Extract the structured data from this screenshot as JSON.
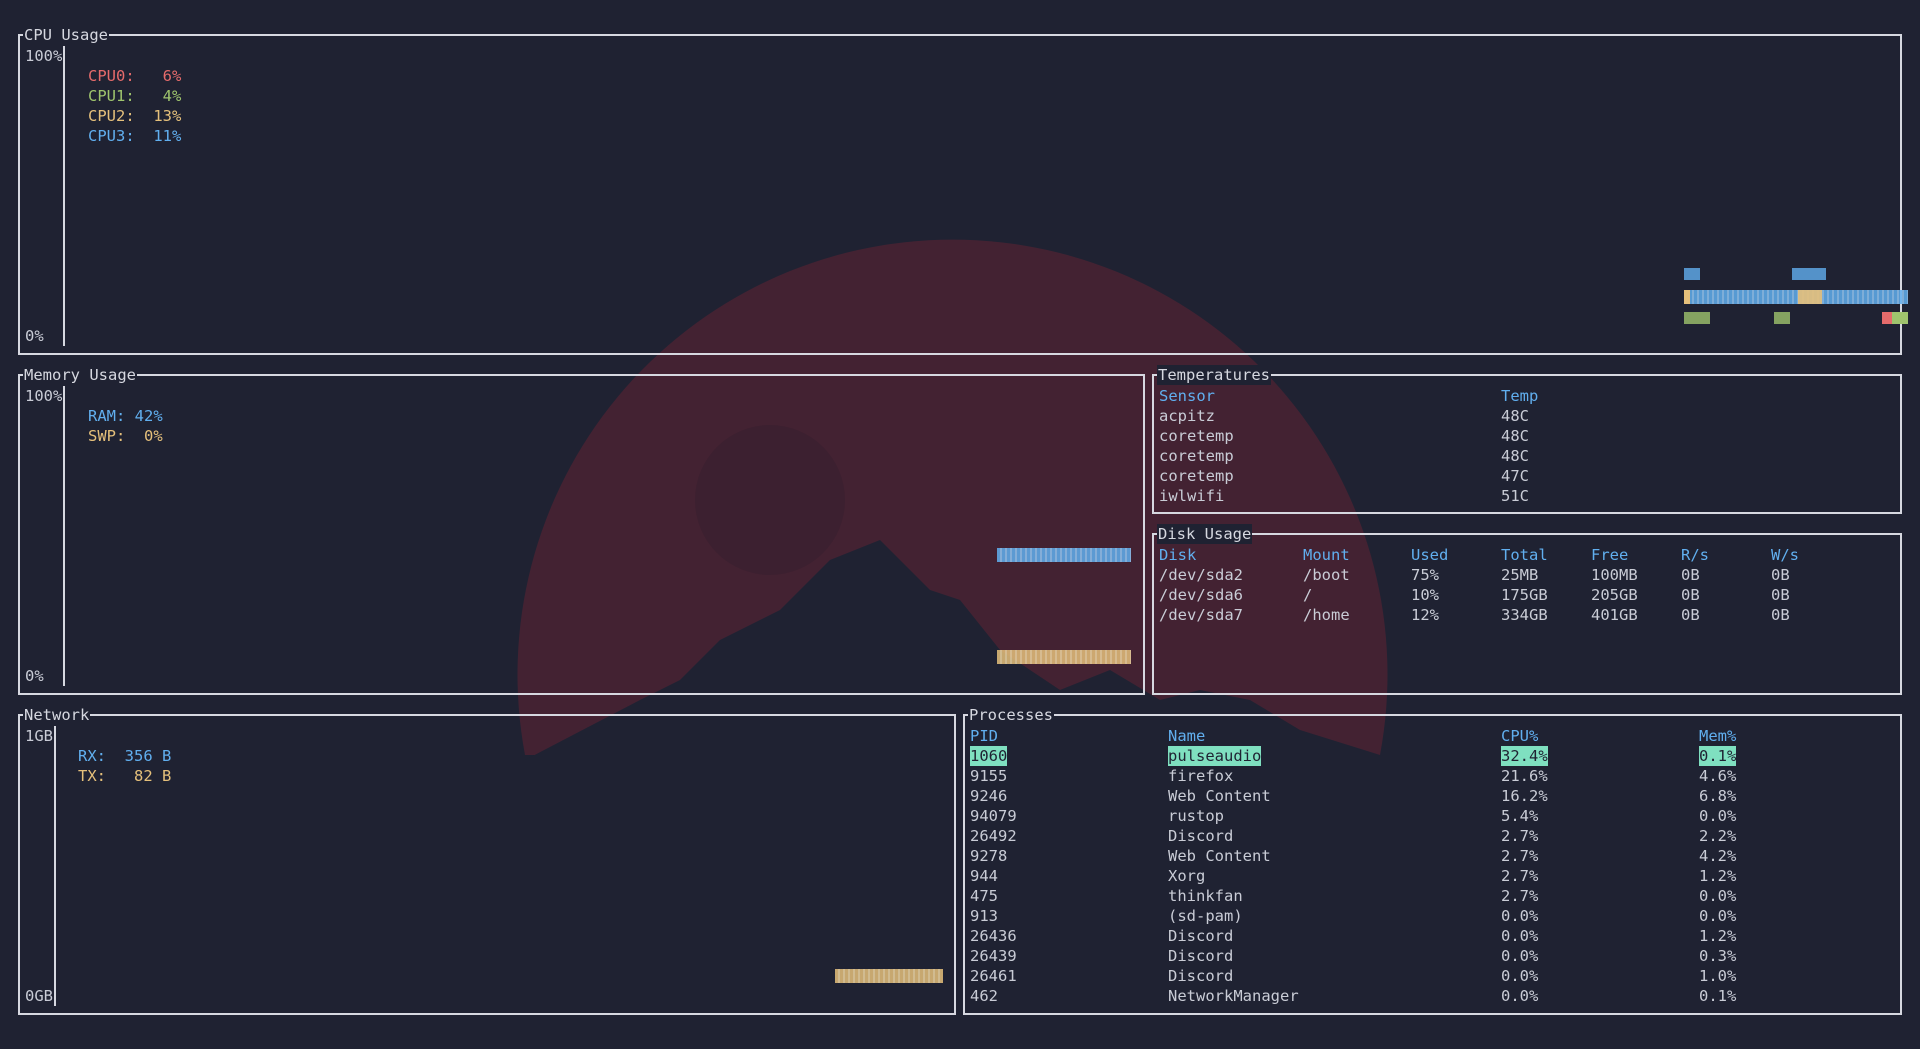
{
  "cpu": {
    "title": "CPU Usage",
    "y_max": "100%",
    "y_min": "0%",
    "cores": [
      {
        "name": "CPU0:",
        "value": "6%",
        "color": "#e56b6b"
      },
      {
        "name": "CPU1:",
        "value": "4%",
        "color": "#9fc46d"
      },
      {
        "name": "CPU2:",
        "value": "13%",
        "color": "#e5c07b"
      },
      {
        "name": "CPU3:",
        "value": "11%",
        "color": "#61afef"
      }
    ]
  },
  "memory": {
    "title": "Memory Usage",
    "y_max": "100%",
    "y_min": "0%",
    "ram": {
      "label": "RAM:",
      "value": "42%",
      "color": "#61afef"
    },
    "swp": {
      "label": "SWP:",
      "value": "0%",
      "color": "#e5c07b"
    }
  },
  "temperatures": {
    "title": "Temperatures",
    "columns": [
      "Sensor",
      "Temp"
    ],
    "rows": [
      [
        "acpitz",
        "48C"
      ],
      [
        "coretemp",
        "48C"
      ],
      [
        "coretemp",
        "48C"
      ],
      [
        "coretemp",
        "47C"
      ],
      [
        "iwlwifi",
        "51C"
      ]
    ]
  },
  "disk": {
    "title": "Disk Usage",
    "columns": [
      "Disk",
      "Mount",
      "Used",
      "Total",
      "Free",
      "R/s",
      "W/s"
    ],
    "rows": [
      [
        "/dev/sda2",
        "/boot",
        "75%",
        "25MB",
        "100MB",
        "0B",
        "0B"
      ],
      [
        "/dev/sda6",
        "/",
        "10%",
        "175GB",
        "205GB",
        "0B",
        "0B"
      ],
      [
        "/dev/sda7",
        "/home",
        "12%",
        "334GB",
        "401GB",
        "0B",
        "0B"
      ]
    ]
  },
  "network": {
    "title": "Network",
    "y_max": "1GB",
    "y_min": "0GB",
    "rx": {
      "label": "RX:",
      "value": "356 B",
      "color": "#61afef"
    },
    "tx": {
      "label": "TX:",
      "value": "82 B",
      "color": "#e5c07b"
    }
  },
  "processes": {
    "title": "Processes",
    "columns": [
      "PID",
      "Name",
      "CPU%",
      "Mem%"
    ],
    "rows": [
      [
        "1060",
        "pulseaudio",
        "32.4%",
        "0.1%"
      ],
      [
        "9155",
        "firefox",
        "21.6%",
        "4.6%"
      ],
      [
        "9246",
        "Web Content",
        "16.2%",
        "6.8%"
      ],
      [
        "94079",
        "rustop",
        "5.4%",
        "0.0%"
      ],
      [
        "26492",
        "Discord",
        "2.7%",
        "2.2%"
      ],
      [
        "9278",
        "Web Content",
        "2.7%",
        "4.2%"
      ],
      [
        "944",
        "Xorg",
        "2.7%",
        "1.2%"
      ],
      [
        "475",
        "thinkfan",
        "2.7%",
        "0.0%"
      ],
      [
        "913",
        "(sd-pam)",
        "0.0%",
        "0.0%"
      ],
      [
        "26436",
        "Discord",
        "0.0%",
        "1.2%"
      ],
      [
        "26439",
        "Discord",
        "0.0%",
        "0.3%"
      ],
      [
        "26461",
        "Discord",
        "0.0%",
        "1.0%"
      ],
      [
        "462",
        "NetworkManager",
        "0.0%",
        "0.1%"
      ]
    ],
    "selected_index": 0
  },
  "theme": {
    "background": "#1f2232",
    "border": "#d6d8e0",
    "header": "#61afef",
    "highlight": "#7fe0c0",
    "wallpaper_accent": "#5a2534"
  }
}
